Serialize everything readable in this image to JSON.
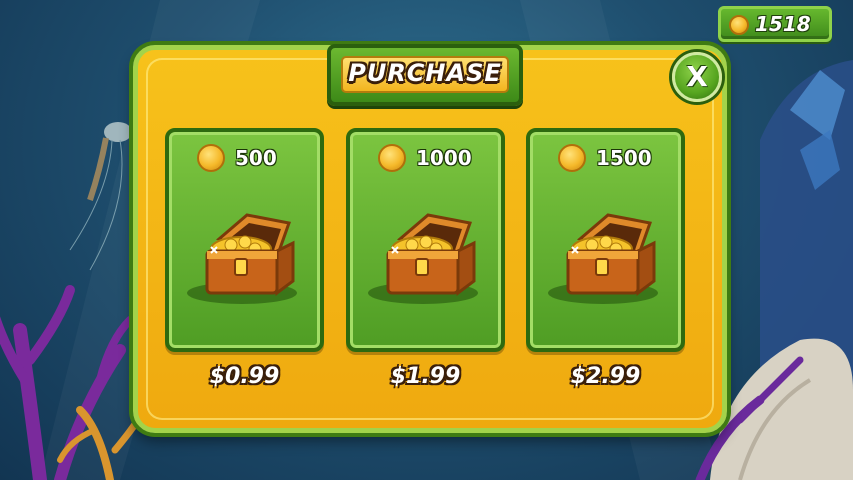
{
  "hud": {
    "coin_balance": "1518",
    "coin_icon": "coin-icon"
  },
  "dialog": {
    "title": "PURCHASE",
    "close_label": "X"
  },
  "offers": [
    {
      "coins": "500",
      "price": "$0.99",
      "icon": "treasure-chest-icon"
    },
    {
      "coins": "1000",
      "price": "$1.99",
      "icon": "treasure-chest-icon"
    },
    {
      "coins": "1500",
      "price": "$2.99",
      "icon": "treasure-chest-icon"
    }
  ],
  "colors": {
    "panel": "#f5b91a",
    "card_green": "#5fae2e",
    "border_green": "#2e6a0f",
    "coin_gold": "#f5b92a",
    "ocean": "#1f4f6f"
  }
}
